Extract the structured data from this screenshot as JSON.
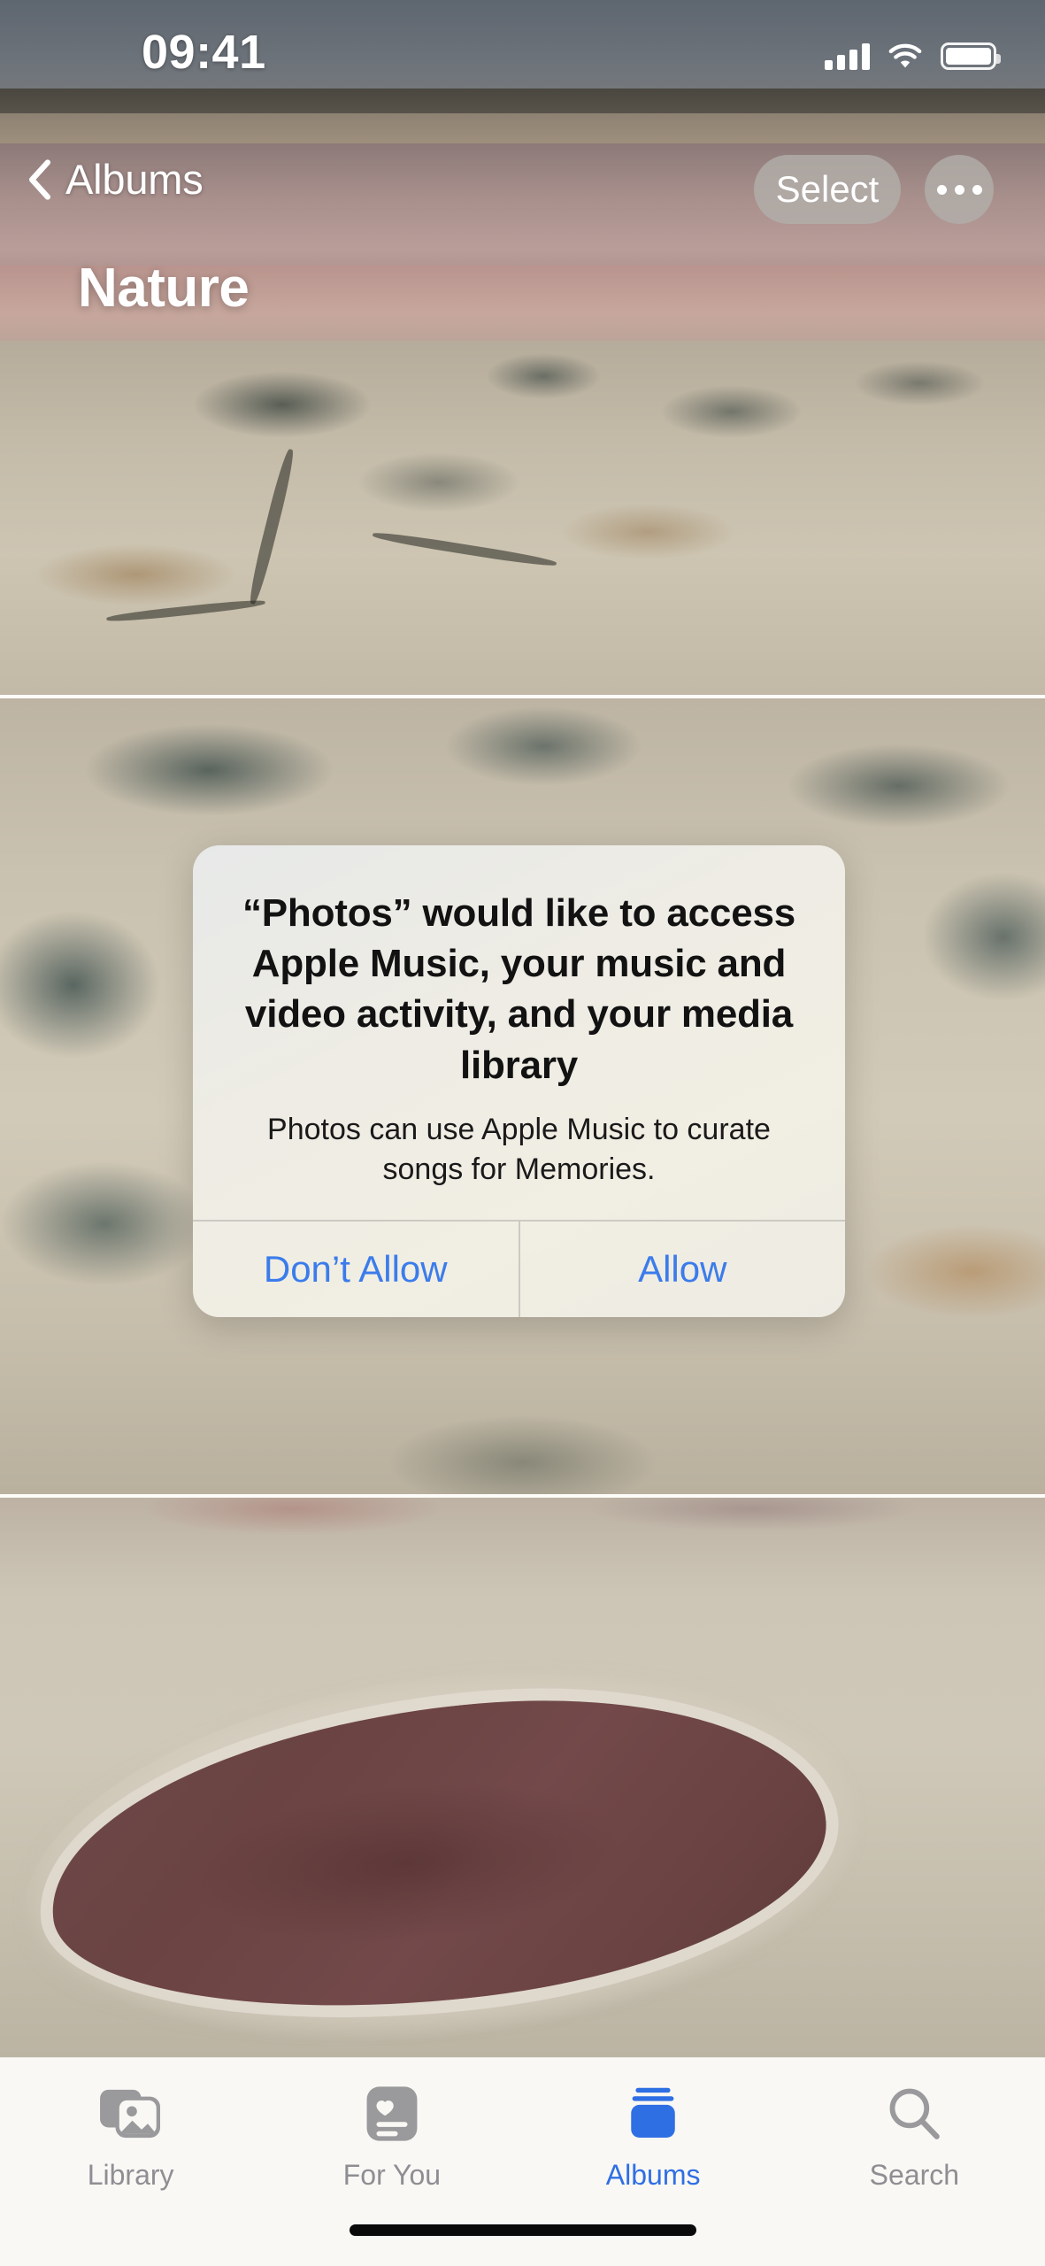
{
  "status_bar": {
    "time": "09:41",
    "icons": [
      "cellular-signal-icon",
      "wifi-icon",
      "battery-icon"
    ],
    "battery_level": "100"
  },
  "nav_bar": {
    "back_label": "Albums",
    "back_icon": "chevron-left-icon",
    "select_label": "Select",
    "more_icon": "ellipsis-icon",
    "album_title": "Nature"
  },
  "content": {
    "photos": [
      {
        "name": "desert-shoreline-photo",
        "alt": "Pink salt lake shoreline with desert crust"
      },
      {
        "name": "salt-crust-pools-photo",
        "alt": "Mineral crust with dark green pools"
      },
      {
        "name": "red-lagoon-photo",
        "alt": "Deep red lagoon surrounded by white salt flats"
      }
    ]
  },
  "alert": {
    "title": "“Photos” would like to access Apple Music, your music and video activity, and your media library",
    "message": "Photos can use Apple Music to curate songs for Memories.",
    "buttons": [
      {
        "label": "Don’t Allow",
        "role": "cancel"
      },
      {
        "label": "Allow",
        "role": "default"
      }
    ],
    "accent_color": "#3b7ceb"
  },
  "tab_bar": {
    "active": "Albums",
    "inactive_color": "#8e8e93",
    "active_color": "#2f6fe4",
    "tabs": [
      {
        "label": "Library",
        "icon": "photo-stack-icon"
      },
      {
        "label": "For You",
        "icon": "heart-card-icon"
      },
      {
        "label": "Albums",
        "icon": "albums-stack-icon"
      },
      {
        "label": "Search",
        "icon": "magnifier-icon"
      }
    ]
  },
  "home_indicator": {
    "name": "home-indicator"
  }
}
